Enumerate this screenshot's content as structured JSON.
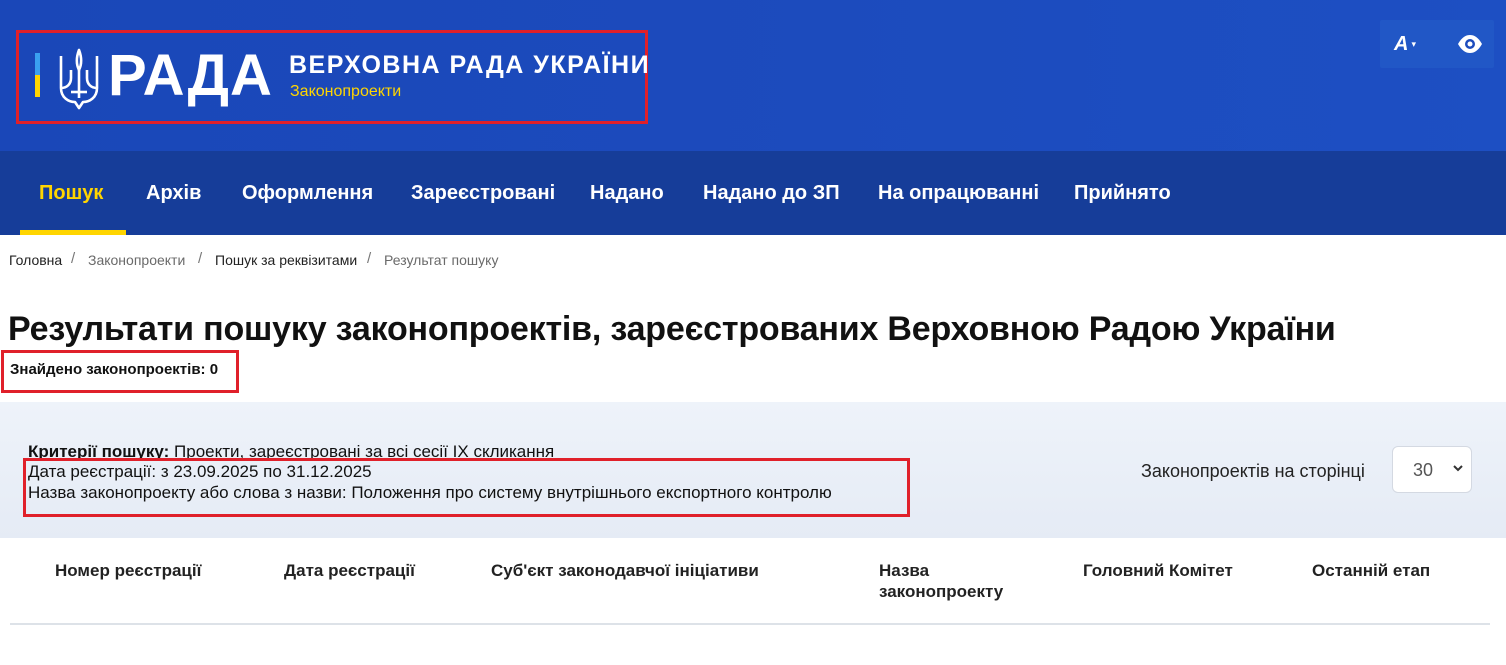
{
  "header": {
    "logo_word": "РАДА",
    "logo_title": "ВЕРХОВНА РАДА УКРАЇНИ",
    "logo_subtitle": "Законопроекти",
    "font_size_button": "A",
    "font_caret": "▾",
    "icons": [
      "trident-icon",
      "chevron-down-icon",
      "eye-icon"
    ]
  },
  "nav": {
    "items": [
      {
        "label": "Пошук",
        "active": true
      },
      {
        "label": "Архів"
      },
      {
        "label": "Оформлення"
      },
      {
        "label": "Зареєстровані"
      },
      {
        "label": "Надано"
      },
      {
        "label": "Надано до ЗП"
      },
      {
        "label": "На опрацюванні"
      },
      {
        "label": "Прийнято"
      }
    ]
  },
  "breadcrumb": {
    "items": [
      "Головна",
      "Законопроекти",
      "Пошук за реквізитами",
      "Результат пошуку"
    ],
    "separator": "/"
  },
  "page": {
    "title": "Результати пошуку законопроектів, зареєстрованих Верховною Радою України",
    "found_label": "Знайдено законопроектів:",
    "found_count": "0"
  },
  "criteria": {
    "label": "Критерії пошуку:",
    "value": "Проекти, зареєстровані за всі сесії IX скликання",
    "date_line": "Дата реєстрації: з 23.09.2025 по 31.12.2025",
    "name_line": "Назва законопроекту або слова з назви: Положення про систему внутрішнього експортного контролю",
    "per_page_label": "Законопроектів на сторінці",
    "per_page_value": "30"
  },
  "table": {
    "columns": [
      "Номер реєстрації",
      "Дата реєстрації",
      "Суб'єкт законодавчої ініціативи",
      "Назва законопроекту",
      "Головний Комітет",
      "Останній етап"
    ]
  },
  "colors": {
    "header_blue": "#1c4bbd",
    "nav_blue": "#163d99",
    "accent_yellow": "#ffd500",
    "highlight_red": "#e0202a"
  }
}
